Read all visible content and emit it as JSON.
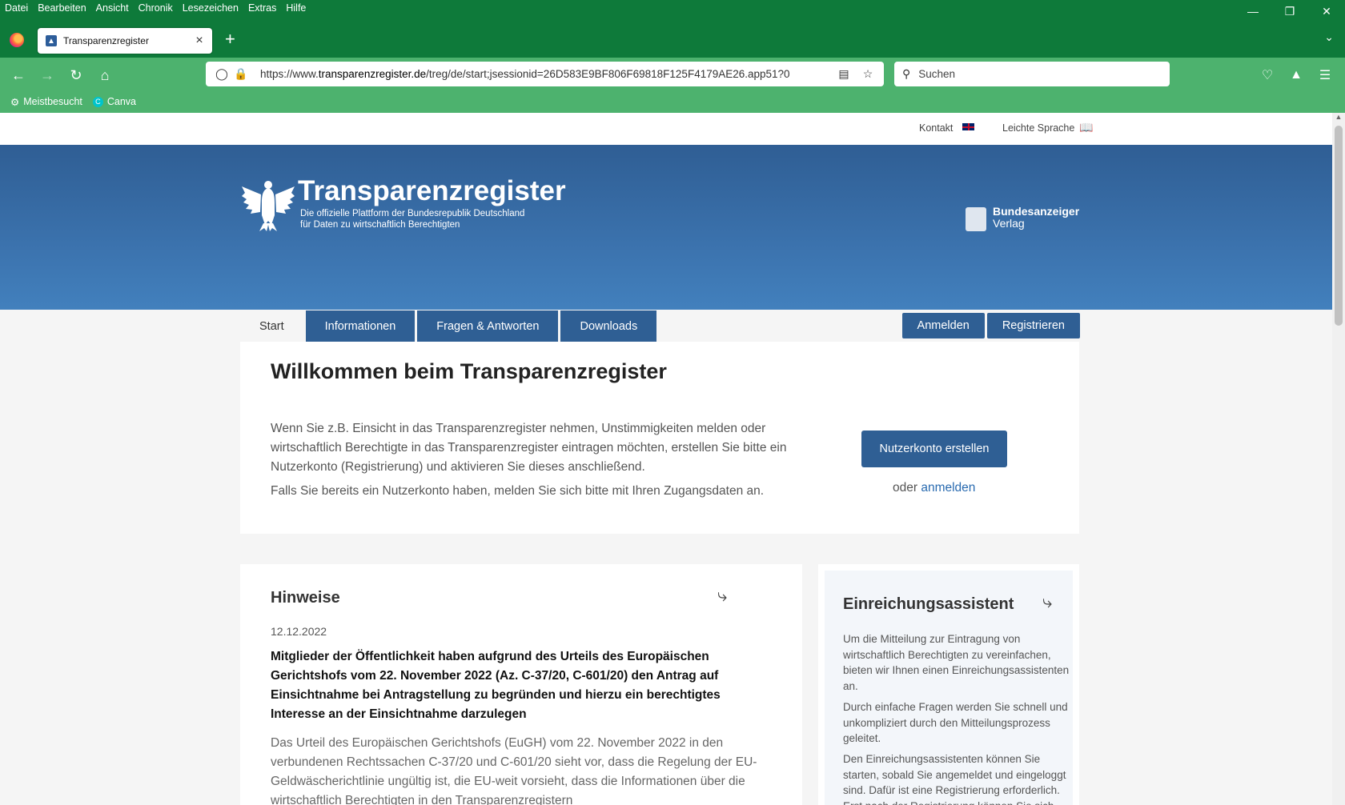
{
  "browser": {
    "menu": [
      "Datei",
      "Bearbeiten",
      "Ansicht",
      "Chronik",
      "Lesezeichen",
      "Extras",
      "Hilfe"
    ],
    "tab_title": "Transparenzregister",
    "url_prefix": "https://www.",
    "url_domain": "transparenzregister.de",
    "url_path": "/treg/de/start;jsessionid=26D583E9BF806F69818F125F4179AE26.app51?0",
    "search_placeholder": "Suchen",
    "bookmarks": [
      "Meistbesucht",
      "Canva"
    ]
  },
  "topbar": {
    "kontakt": "Kontakt",
    "leichte_sprache": "Leichte Sprache"
  },
  "header": {
    "title": "Transparenzregister",
    "subtitle_line1": "Die offizielle Plattform der Bundesrepublik Deutschland",
    "subtitle_line2": "für Daten zu wirtschaftlich Berechtigten",
    "publisher_line1": "Bundesanzeiger",
    "publisher_line2": "Verlag"
  },
  "nav": {
    "tabs": [
      "Start",
      "Informationen",
      "Fragen & Antworten",
      "Downloads"
    ],
    "login": "Anmelden",
    "register": "Registrieren"
  },
  "welcome": {
    "heading": "Willkommen beim Transparenzregister",
    "p1": "Wenn Sie z.B. Einsicht in das Transparenzregister nehmen, Unstimmigkeiten melden oder wirtschaftlich Berechtigte in das Transparenzregister eintragen möchten, erstellen Sie bitte ein Nutzerkonto (Registrierung) und aktivieren Sie dieses anschließend.",
    "p2": "Falls Sie bereits ein Nutzerkonto haben, melden Sie sich bitte mit Ihren Zugangsdaten an.",
    "button": "Nutzerkonto erstellen",
    "or": "oder",
    "login_link": "anmelden"
  },
  "hinweise": {
    "heading": "Hinweise",
    "date": "12.12.2022",
    "headline": "Mitglieder der Öffentlichkeit haben aufgrund des Urteils des Europäischen Gerichtshofs vom 22. November 2022 (Az. C-37/20, C-601/20) den Antrag auf Einsichtnahme bei Antragstellung zu begründen und hierzu ein berechtigtes Interesse an der Einsichtnahme darzulegen",
    "body": "Das Urteil des Europäischen Gerichtshofs (EuGH) vom 22. November 2022 in den verbundenen Rechtssachen C-37/20 und C-601/20 sieht vor, dass die Regelung der EU-Geldwäscherichtlinie ungültig ist, die EU-weit vorsieht, dass die Informationen über die wirtschaftlich Berechtigten in den Transparenzregistern"
  },
  "assistant": {
    "heading": "Einreichungsassistent",
    "p1": "Um die Mitteilung zur Eintragung von wirtschaftlich Berechtigten zu vereinfachen, bieten wir Ihnen einen Einreichungsassistenten an.",
    "p2": "Durch einfache Fragen werden Sie schnell und unkompliziert durch den Mitteilungsprozess geleitet.",
    "p3": "Den Einreichungsassistenten können Sie starten, sobald Sie angemeldet und eingeloggt sind. Dafür ist eine Registrierung erforderlich. Erst nach der Registrierung können Sie sich"
  },
  "colors": {
    "browser_titlebar": "#0e7a3a",
    "browser_toolbar": "#4db26e",
    "hero_dark": "#2f5e94",
    "accent": "#2f5f94",
    "link": "#2a6bb0"
  }
}
